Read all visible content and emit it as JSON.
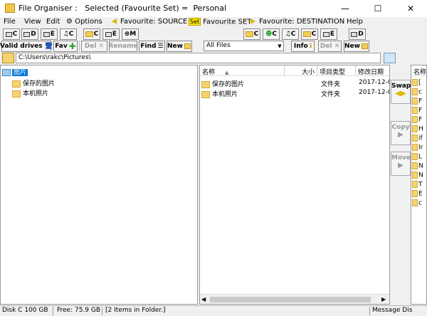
{
  "window": {
    "title": "File Organiser :   Selected (Favourite Set) =  Personal",
    "minimize": "—",
    "maximize": "☐",
    "close": "✕"
  },
  "menu": {
    "file": "File",
    "view": "View",
    "edit": "Edit",
    "options": "Options",
    "fav_source": "Favourite: SOURCE",
    "fav_set_icon": "Set",
    "fav_set": "Favourite SET",
    "fav_destination": "Favourite: DESTINATION",
    "help": "Help"
  },
  "toolbar1": {
    "left_drives": [
      "C",
      "D",
      "E"
    ],
    "music": "C",
    "folders": [
      "C",
      "E"
    ],
    "mtp": "M",
    "right_folders_a": [
      "C"
    ],
    "user": "C",
    "music_right": "C",
    "right_folders_b": [
      "C",
      "E"
    ],
    "far_drive": "D"
  },
  "toolbar2": {
    "valid_drives": "Valid drives",
    "fav": "Fav",
    "del": "Del",
    "rename": "Rename",
    "find": "Find",
    "new": "New",
    "filter": "All Files",
    "info": "Info",
    "del_right": "Del",
    "new_right": "New"
  },
  "path": "C:\\Users\\rakc\\Pictures\\",
  "tree": {
    "root": "图片",
    "children": [
      "保存的图片",
      "本机照片"
    ]
  },
  "list": {
    "columns": [
      "名称",
      "大小",
      "项目类型",
      "修改日期"
    ],
    "rows": [
      {
        "name": "保存的图片",
        "size": "",
        "type": "文件夹",
        "date": "2017-12-0"
      },
      {
        "name": "本机照片",
        "size": "",
        "type": "文件夹",
        "date": "2017-12-0"
      }
    ]
  },
  "side_buttons": {
    "swap": "Swap",
    "copy": "Copy",
    "move": "Move"
  },
  "right_pane": {
    "header": "名称",
    "rows": [
      "[",
      "c",
      "F",
      "F",
      "F",
      "H",
      "if",
      "Ir",
      "L",
      "N",
      "N",
      "T",
      "E",
      "c"
    ]
  },
  "status": {
    "disk": "Disk C 100 GB",
    "free": "Free: 75.9 GB",
    "items": "[2 Items in Folder.]",
    "message": "Message Dis"
  },
  "colors": {
    "folder": "#f7d370",
    "selected": "#0078d7",
    "fav_green": "#2aa52a"
  }
}
